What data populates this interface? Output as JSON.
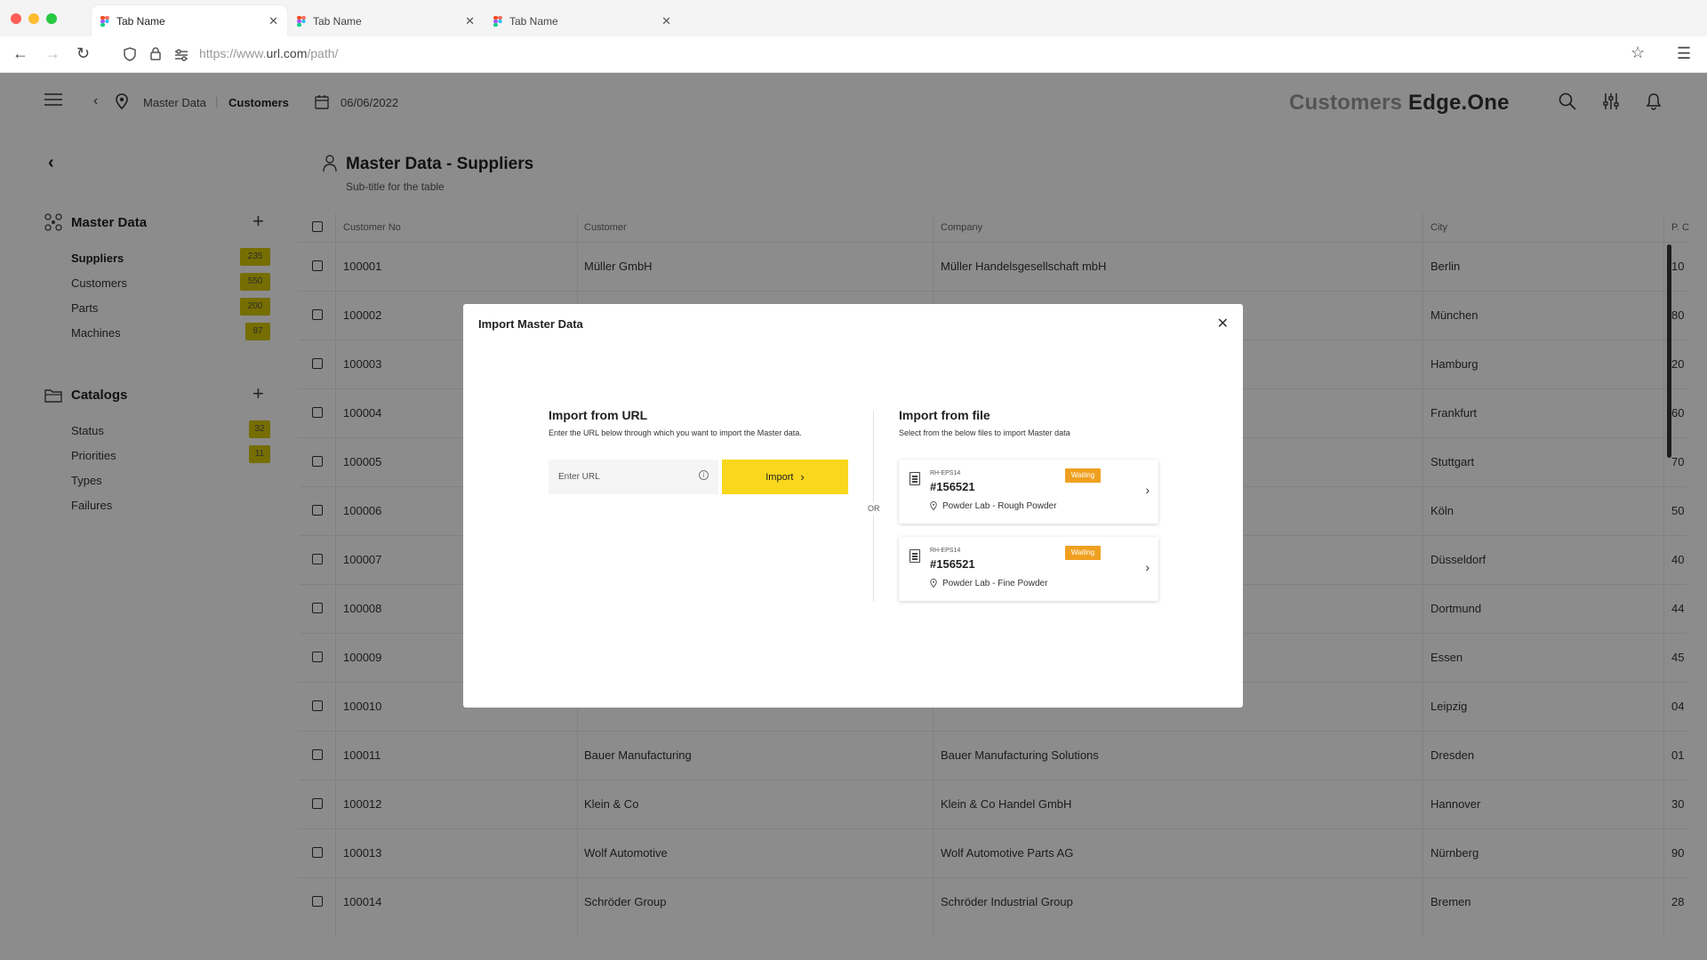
{
  "browser": {
    "tabs": [
      {
        "label": "Tab Name"
      },
      {
        "label": "Tab Name"
      },
      {
        "label": "Tab Name"
      }
    ],
    "url_prefix": "https://www.",
    "url_domain": "url.com",
    "url_path": "/path/"
  },
  "header": {
    "breadcrumb": {
      "parent": "Master Data",
      "current": "Customers"
    },
    "date": "06/06/2022",
    "brand_light": "Customers",
    "brand_bold": "Edge.One"
  },
  "sidebar": {
    "sections": [
      {
        "title": "Master Data",
        "items": [
          {
            "label": "Suppliers",
            "count": "235",
            "active": true
          },
          {
            "label": "Customers",
            "count": "550"
          },
          {
            "label": "Parts",
            "count": "200"
          },
          {
            "label": "Machines",
            "count": "87"
          }
        ]
      },
      {
        "title": "Catalogs",
        "items": [
          {
            "label": "Status",
            "count": "32"
          },
          {
            "label": "Priorities",
            "count": "11"
          },
          {
            "label": "Types",
            "count": ""
          },
          {
            "label": "Failures",
            "count": ""
          }
        ]
      }
    ]
  },
  "main": {
    "title": "Master Data - Suppliers",
    "subtitle": "Sub-title for the table",
    "columns": [
      "Customer No",
      "Customer",
      "Company",
      "City",
      "P. C"
    ],
    "rows": [
      {
        "no": "100001",
        "customer": "Müller GmbH",
        "company": "Müller Handelsgesellschaft mbH",
        "city": "Berlin",
        "pc": "10"
      },
      {
        "no": "100002",
        "customer": "",
        "company": "",
        "city": "München",
        "pc": "80"
      },
      {
        "no": "100003",
        "customer": "",
        "company": "",
        "city": "Hamburg",
        "pc": "20"
      },
      {
        "no": "100004",
        "customer": "",
        "company": "",
        "city": "Frankfurt",
        "pc": "60"
      },
      {
        "no": "100005",
        "customer": "",
        "company": "",
        "city": "Stuttgart",
        "pc": "70"
      },
      {
        "no": "100006",
        "customer": "",
        "company": "",
        "city": "Köln",
        "pc": "50"
      },
      {
        "no": "100007",
        "customer": "",
        "company": "",
        "city": "Düsseldorf",
        "pc": "40"
      },
      {
        "no": "100008",
        "customer": "",
        "company": "",
        "city": "Dortmund",
        "pc": "44"
      },
      {
        "no": "100009",
        "customer": "",
        "company": "",
        "city": "Essen",
        "pc": "45"
      },
      {
        "no": "100010",
        "customer": "",
        "company": "",
        "city": "Leipzig",
        "pc": "04"
      },
      {
        "no": "100011",
        "customer": "Bauer Manufacturing",
        "company": "Bauer Manufacturing Solutions",
        "city": "Dresden",
        "pc": "01"
      },
      {
        "no": "100012",
        "customer": "Klein & Co",
        "company": "Klein & Co Handel GmbH",
        "city": "Hannover",
        "pc": "30"
      },
      {
        "no": "100013",
        "customer": "Wolf Automotive",
        "company": "Wolf Automotive Parts AG",
        "city": "Nürnberg",
        "pc": "90"
      },
      {
        "no": "100014",
        "customer": "Schröder Group",
        "company": "Schröder Industrial Group",
        "city": "Bremen",
        "pc": "28"
      }
    ]
  },
  "modal": {
    "title": "Import Master Data",
    "url_section": {
      "title": "Import from URL",
      "description": "Enter the URL below through which you want to import the Master data.",
      "placeholder": "Enter URL",
      "button": "Import"
    },
    "or_label": "OR",
    "file_section": {
      "title": "Import from file",
      "description": "Select from the below files to import Master data",
      "files": [
        {
          "code": "RH-EPS14",
          "number": "#156521",
          "status": "Waiting",
          "location": "Powder Lab - Rough Powder"
        },
        {
          "code": "RH-EPS14",
          "number": "#156521",
          "status": "Waiting",
          "location": "Powder Lab - Fine Powder"
        }
      ]
    }
  },
  "colors": {
    "accent": "#f8d71d",
    "badge": "#d7c800",
    "status_waiting": "#f0a020"
  }
}
